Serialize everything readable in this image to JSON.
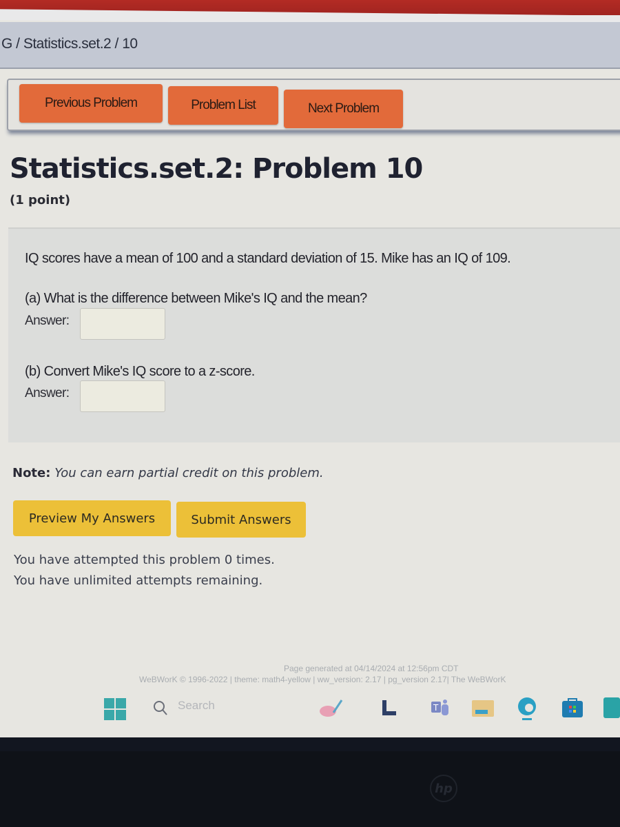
{
  "breadcrumb": {
    "text": "G  /  Statistics.set.2  /  10"
  },
  "nav": {
    "previous_label": "Previous Problem",
    "list_label": "Problem List",
    "next_label": "Next Problem",
    "button_color": "#e26a3a"
  },
  "problem": {
    "title": "Statistics.set.2: Problem 10",
    "points": "(1 point)",
    "intro": "IQ scores have a mean of 100 and a standard deviation of 15. Mike has an IQ of 109.",
    "parts": [
      {
        "question": "(a) What is the difference between Mike's IQ and the mean?",
        "answer_label": "Answer:",
        "answer_value": ""
      },
      {
        "question": "(b) Convert Mike's IQ score to a z-score.",
        "answer_label": "Answer:",
        "answer_value": ""
      }
    ],
    "note_label": "Note:",
    "note_text": "You can earn partial credit on this problem."
  },
  "actions": {
    "preview_label": "Preview My Answers",
    "submit_label": "Submit Answers",
    "button_color": "#ecc038"
  },
  "attempts": {
    "line1": "You have attempted this problem 0 times.",
    "line2": "You have unlimited attempts remaining."
  },
  "footer": {
    "generated": "Page generated at 04/14/2024 at 12:56pm CDT",
    "credits": "WeBWorK © 1996-2022 | theme: math4-yellow | ww_version: 2.17 | pg_version 2.17| The WeBWorK"
  },
  "taskbar": {
    "search_label": "Search",
    "icons": [
      "windows-start-icon",
      "search-icon",
      "paint-icon",
      "app-l-icon",
      "teams-icon",
      "file-explorer-icon",
      "edge-icon",
      "microsoft-store-icon",
      "mywork-app-icon"
    ]
  }
}
